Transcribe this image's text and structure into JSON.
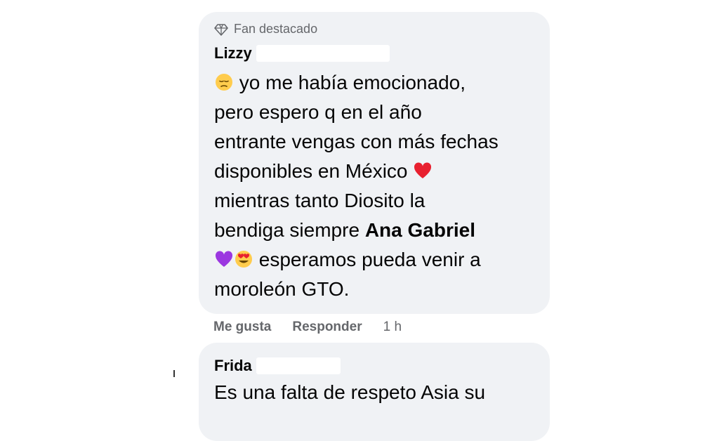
{
  "comments": [
    {
      "badge": "Fan destacado",
      "author": "Lizzy",
      "lines": [
        "yo me había emocionado,",
        "pero espero q en el año",
        "entrante vengas con más fechas",
        "disponibles en México",
        "mientras tanto Diosito la",
        "bendiga siempre",
        "esperamos pueda venir a",
        "moroleón GTO."
      ],
      "mention": "Ana Gabriel",
      "emojis": [
        "pensive-face",
        "red-heart",
        "purple-heart",
        "heart-eyes-face"
      ],
      "actions": {
        "like": "Me gusta",
        "reply": "Responder",
        "time": "1 h"
      }
    },
    {
      "author": "Frida",
      "lines": [
        "Es una falta de respeto Asia su"
      ]
    }
  ],
  "colors": {
    "bubble": "#f0f2f5",
    "text": "#050505",
    "secondary": "#65676b",
    "heart_red": "#e8202f",
    "heart_purple": "#9b37e0"
  }
}
